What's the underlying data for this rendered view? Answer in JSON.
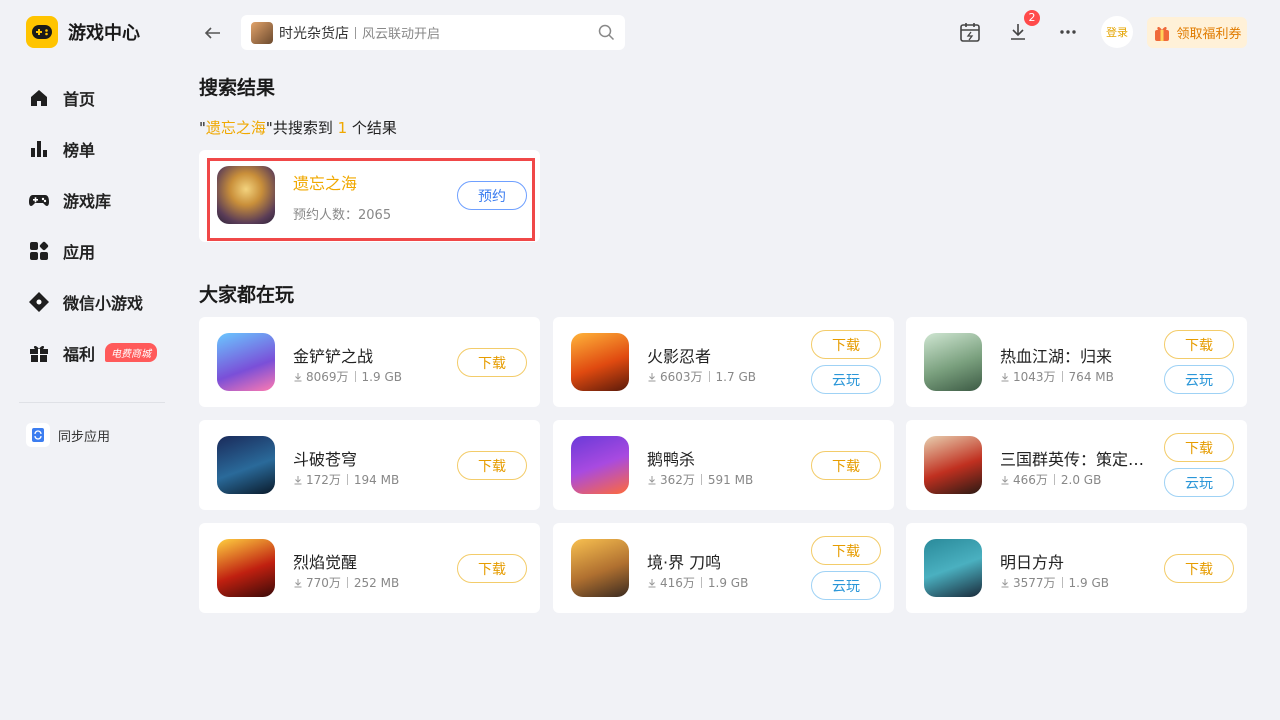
{
  "app": {
    "title": "游戏中心"
  },
  "sidebar": {
    "items": [
      {
        "label": "首页",
        "icon": "home-icon"
      },
      {
        "label": "榜单",
        "icon": "ranking-icon"
      },
      {
        "label": "游戏库",
        "icon": "gamepad-icon"
      },
      {
        "label": "应用",
        "icon": "apps-icon"
      },
      {
        "label": "微信小游戏",
        "icon": "mini-game-icon"
      },
      {
        "label": "福利",
        "icon": "gift-icon",
        "badge": "电费商城"
      }
    ],
    "sync_label": "同步应用"
  },
  "header": {
    "search": {
      "value": "时光杂货店",
      "hint": "风云联动开启"
    },
    "download_badge": "2",
    "login_label": "登录",
    "coupon_label": "领取福利券"
  },
  "search_results": {
    "title": "搜索结果",
    "summary": {
      "quote_open": "\"",
      "query": "遗忘之海",
      "mid": "\"共搜索到 ",
      "count": "1",
      "suffix": " 个结果"
    },
    "item": {
      "name": "遗忘之海",
      "subtitle": "预约人数：2065",
      "button": "预约"
    }
  },
  "popular": {
    "title": "大家都在玩",
    "download_label": "下载",
    "cloud_label": "云玩",
    "games": [
      {
        "name": "金铲铲之战",
        "downloads": "8069万",
        "size": "1.9 GB",
        "cloud": false
      },
      {
        "name": "火影忍者",
        "downloads": "6603万",
        "size": "1.7 GB",
        "cloud": true
      },
      {
        "name": "热血江湖：归来",
        "downloads": "1043万",
        "size": "764 MB",
        "cloud": true
      },
      {
        "name": "斗破苍穹",
        "downloads": "172万",
        "size": "194 MB",
        "cloud": false
      },
      {
        "name": "鹅鸭杀",
        "downloads": "362万",
        "size": "591 MB",
        "cloud": false
      },
      {
        "name": "三国群英传：策定九州",
        "downloads": "466万",
        "size": "2.0 GB",
        "cloud": true
      },
      {
        "name": "烈焰觉醒",
        "downloads": "770万",
        "size": "252 MB",
        "cloud": false
      },
      {
        "name": "境·界 刀鸣",
        "downloads": "416万",
        "size": "1.9 GB",
        "cloud": true
      },
      {
        "name": "明日方舟",
        "downloads": "3577万",
        "size": "1.9 GB",
        "cloud": false
      }
    ]
  },
  "colors": {
    "accent": "#f0a800",
    "highlight_border": "#f04848",
    "reserve_blue": "#3c7df0",
    "cloud_blue": "#2a96d8"
  }
}
